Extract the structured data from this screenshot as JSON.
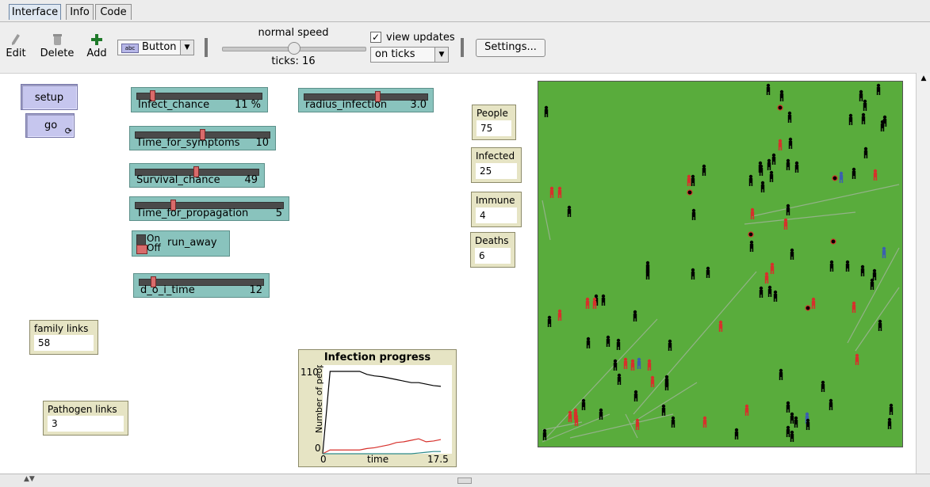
{
  "tabs": [
    {
      "label": "Interface",
      "active": true
    },
    {
      "label": "Info",
      "active": false
    },
    {
      "label": "Code",
      "active": false
    }
  ],
  "toolbar": {
    "edit_label": "Edit",
    "delete_label": "Delete",
    "add_label": "Add",
    "widget_type_prefix": "abc",
    "widget_type": "Button",
    "speed_label": "normal speed",
    "speed_level": 0.5,
    "ticks_text": "ticks: 16",
    "view_updates_label": "view updates",
    "view_updates_checked": true,
    "update_mode": "on ticks",
    "settings_label": "Settings..."
  },
  "buttons": {
    "setup_label": "setup",
    "go_label": "go"
  },
  "sliders": [
    {
      "id": "infect-chance",
      "label": "Infect_chance",
      "value": "11 %",
      "level": 0.11
    },
    {
      "id": "radius-infection",
      "label": "radius_infection",
      "value": "3.0",
      "level": 0.6
    },
    {
      "id": "time-for-symptoms",
      "label": "Time_for_symptoms",
      "value": "10",
      "level": 0.5
    },
    {
      "id": "survival-chance",
      "label": "Survival_chance",
      "value": "49",
      "level": 0.49
    },
    {
      "id": "time-for-propagation",
      "label": "Time_for_propagation",
      "value": "5",
      "level": 0.25
    },
    {
      "id": "d-o-i-time",
      "label": "d_o_i_time",
      "value": "12",
      "level": 0.1
    }
  ],
  "switch": {
    "label": "run_away",
    "on_text": "On",
    "off_text": "Off",
    "state": "Off"
  },
  "monitors": {
    "people": {
      "label": "People",
      "value": "75"
    },
    "infected": {
      "label": "Infected",
      "value": "25"
    },
    "immune": {
      "label": "Immune",
      "value": "4"
    },
    "deaths": {
      "label": "Deaths",
      "value": "6"
    },
    "family_links": {
      "label": "family links",
      "value": "58"
    },
    "pathogen_links": {
      "label": "Pathogen links",
      "value": "3"
    }
  },
  "plot": {
    "title": "Infection progress",
    "ylabel": "Number of people",
    "xlabel": "time",
    "ymax_label": "110",
    "ymin_label": "0",
    "xmin_label": "0",
    "xmax_label": "17.5"
  },
  "chart_data": {
    "type": "line",
    "title": "Infection progress",
    "xlabel": "time",
    "ylabel": "Number of people",
    "xlim": [
      0,
      17.5
    ],
    "ylim": [
      0,
      110
    ],
    "grid": false,
    "series": [
      {
        "color": "#000000",
        "x": [
          0,
          1,
          2,
          3,
          4,
          5,
          6,
          7,
          8,
          9,
          10,
          11,
          12,
          13,
          14,
          15,
          16
        ],
        "values": [
          0,
          110,
          110,
          110,
          110,
          110,
          106,
          104,
          103,
          101,
          99,
          97,
          95,
          95,
          93,
          91,
          90
        ]
      },
      {
        "color": "#d7302b",
        "x": [
          0,
          1,
          2,
          3,
          4,
          5,
          6,
          7,
          8,
          9,
          10,
          11,
          12,
          13,
          14,
          15,
          16
        ],
        "values": [
          0,
          5,
          5,
          5,
          5,
          5,
          7,
          8,
          10,
          12,
          15,
          16,
          18,
          20,
          16,
          17,
          19
        ]
      },
      {
        "color": "#2e8b8b",
        "x": [
          0,
          1,
          2,
          3,
          4,
          5,
          6,
          7,
          8,
          9,
          10,
          11,
          12,
          13,
          14,
          15,
          16
        ],
        "values": [
          0,
          0,
          0,
          0,
          0,
          0,
          0,
          0,
          0,
          0,
          0,
          0,
          0,
          1,
          2,
          3,
          3
        ]
      }
    ]
  },
  "colors": {
    "world_background": "#59ac3c",
    "healthy": "#000000",
    "infected": "#d7302b",
    "immune": "#3b5fb0",
    "link": "#9fae9c"
  }
}
